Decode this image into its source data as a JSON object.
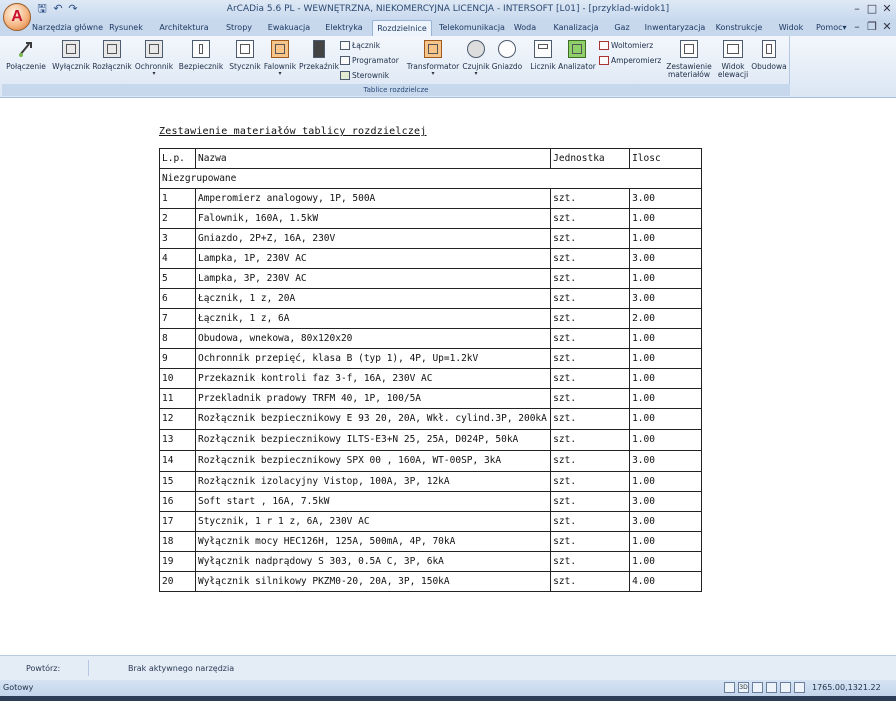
{
  "window": {
    "title": "ArCADia 5.6 PL - WEWNĘTRZNA, NIEKOMERCYJNA LICENCJA - INTERSOFT [L01] - [przyklad-widok1]",
    "logo_letter": "A",
    "quick_access": {
      "save": "🖫",
      "undo": "↶",
      "redo": "↷"
    },
    "controls": {
      "minimize": "–",
      "maximize": "□",
      "close": "✕"
    }
  },
  "menu": {
    "tabs": [
      "Narzędzia główne",
      "Rysunek",
      "Architektura",
      "Stropy",
      "Ewakuacja",
      "Elektryka",
      "Rozdzielnice",
      "Telekomunikacja",
      "Woda",
      "Kanalizacja",
      "Gaz",
      "Inwentaryzacja",
      "Konstrukcje",
      "Widok"
    ],
    "active_tab": "Rozdzielnice",
    "help": "Pomoc",
    "help_arrow": "▾",
    "inner_controls": {
      "minimize": "–",
      "restore": "❐",
      "close": "✕"
    }
  },
  "ribbon": {
    "group_label": "Tablice rozdzielcze",
    "buttons": {
      "polaczenie": "Połączenie",
      "wylacznik": "Wyłącznik",
      "rozlacznik": "Rozłącznik",
      "ochronnik": "Ochronnik",
      "bezpiecznik": "Bezpiecznik",
      "stycznik": "Stycznik",
      "falownik": "Falownik",
      "przekaznik": "Przekaźnik",
      "lacznik": "Łącznik",
      "programator": "Programator",
      "sterownik": "Sterownik",
      "transformator": "Transformator",
      "czujnik": "Czujnik",
      "gniazdo": "Gniazdo",
      "licznik": "Licznik",
      "analizator": "Analizator",
      "woltomierz": "Woltomierz",
      "amperomierz": "Amperomierz",
      "zestawienie_1": "Zestawienie",
      "zestawienie_2": "materiałów",
      "widok_1": "Widok",
      "widok_2": "elewacji",
      "obudowa": "Obudowa"
    },
    "arrow": "▾"
  },
  "document": {
    "title": "Zestawienie materiałów tablicy rozdzielczej",
    "columns": {
      "lp": "L.p.",
      "name": "Nazwa",
      "unit": "Jednostka",
      "qty": "Ilosc"
    },
    "group": "Niezgrupowane",
    "rows": [
      {
        "lp": "1",
        "name": "Amperomierz analogowy, 1P, 500A",
        "unit": "szt.",
        "qty": "3.00"
      },
      {
        "lp": "2",
        "name": "Falownik, 160A, 1.5kW",
        "unit": "szt.",
        "qty": "1.00"
      },
      {
        "lp": "3",
        "name": "Gniazdo, 2P+Z, 16A, 230V",
        "unit": "szt.",
        "qty": "1.00"
      },
      {
        "lp": "4",
        "name": "Lampka, 1P, 230V AC",
        "unit": "szt.",
        "qty": "3.00"
      },
      {
        "lp": "5",
        "name": "Lampka, 3P, 230V AC",
        "unit": "szt.",
        "qty": "1.00"
      },
      {
        "lp": "6",
        "name": "Łącznik, 1 z, 20A",
        "unit": "szt.",
        "qty": "3.00"
      },
      {
        "lp": "7",
        "name": "Łącznik, 1 z, 6A",
        "unit": "szt.",
        "qty": "2.00"
      },
      {
        "lp": "8",
        "name": "Obudowa, wnekowa, 80x120x20",
        "unit": "szt.",
        "qty": "1.00"
      },
      {
        "lp": "9",
        "name": "Ochronnik przepięć, klasa B (typ 1), 4P, Up=1.2kV",
        "unit": "szt.",
        "qty": "1.00"
      },
      {
        "lp": "10",
        "name": "Przekaznik kontroli faz 3-f, 16A, 230V AC",
        "unit": "szt.",
        "qty": "1.00"
      },
      {
        "lp": "11",
        "name": "Przekladnik pradowy TRFM 40, 1P, 100/5A",
        "unit": "szt.",
        "qty": "1.00"
      },
      {
        "lp": "12",
        "name": "Rozłącznik bezpiecznikowy E 93 20, 20A, Wkł. cylind.3P, 200kA",
        "unit": "szt.",
        "qty": "1.00"
      },
      {
        "lp": "13",
        "name": "Rozłącznik bezpiecznikowy ILTS-E3+N 25, 25A, D024P, 50kA",
        "unit": "szt.",
        "qty": "1.00"
      },
      {
        "lp": "14",
        "name": "Rozłącznik bezpiecznikowy SPX 00 , 160A, WT-00SP, 3kA",
        "unit": "szt.",
        "qty": "3.00"
      },
      {
        "lp": "15",
        "name": "Rozłącznik izolacyjny Vistop, 100A, 3P, 12kA",
        "unit": "szt.",
        "qty": "1.00"
      },
      {
        "lp": "16",
        "name": "Soft start , 16A, 7.5kW",
        "unit": "szt.",
        "qty": "3.00"
      },
      {
        "lp": "17",
        "name": "Stycznik, 1 r 1 z, 6A, 230V AC",
        "unit": "szt.",
        "qty": "3.00"
      },
      {
        "lp": "18",
        "name": "Wyłącznik mocy HEC126H, 125A, 500mA, 4P, 70kA",
        "unit": "szt.",
        "qty": "1.00"
      },
      {
        "lp": "19",
        "name": "Wyłącznik nadprądowy S 303, 0.5A C, 3P, 6kA",
        "unit": "szt.",
        "qty": "1.00"
      },
      {
        "lp": "20",
        "name": "Wyłącznik silnikowy PKZM0-20, 20A, 3P, 150kA",
        "unit": "szt.",
        "qty": "4.00"
      }
    ]
  },
  "command_line": {
    "label": "Powtórz:",
    "text": "Brak aktywnego narzędzia"
  },
  "status": {
    "ready": "Gotowy",
    "coords": "1765.00,1321.22",
    "tool_3d": "3D"
  }
}
